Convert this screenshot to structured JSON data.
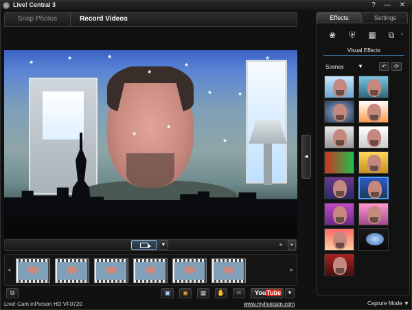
{
  "app": {
    "title": "Live! Central 3",
    "controls": {
      "help": "?",
      "minimize": "—",
      "close": "✕"
    }
  },
  "tabs": [
    {
      "label": "Snap Photos",
      "active": false
    },
    {
      "label": "Record Videos",
      "active": true
    }
  ],
  "record_controls": {
    "record_button_icon": "video-camera-icon",
    "dropdown_glyph": "▼",
    "mic_icon": "microphone-icon"
  },
  "filmstrip": {
    "left_arrow": "◄",
    "right_arrow": "►",
    "thumbnails": [
      "video-1",
      "video-2",
      "video-3",
      "video-4",
      "video-5",
      "video-6"
    ]
  },
  "toolbar": {
    "youtube_you": "You",
    "youtube_tube": "Tube",
    "dropdown_glyph": "▼",
    "buttons": [
      "copy-icon",
      "image-icon",
      "burn-icon",
      "film-icon",
      "hand-icon",
      "email-icon"
    ]
  },
  "status": {
    "device": "Live! Cam inPerson HD VF0720",
    "link": "www.mylivecam.com",
    "capture_mode": "Capture Mode",
    "capture_mode_arrow": "▼"
  },
  "panel": {
    "tabs": [
      {
        "label": "Effects",
        "active": true
      },
      {
        "label": "Settings",
        "active": false
      }
    ],
    "section_title": "Visual Effects",
    "scenes_label": "Scenes",
    "scenes_arrow": "▼",
    "collapse_arrow": "◄",
    "more_arrow": "›",
    "effects_count": 17,
    "colors": {
      "accent": "#4aa2ff",
      "youtube_red": "#d4271b"
    }
  }
}
